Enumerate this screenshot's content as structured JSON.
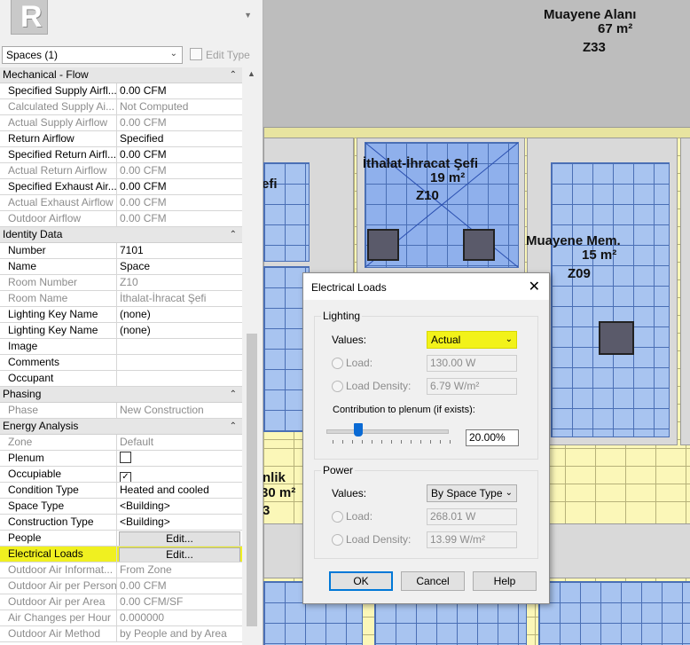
{
  "properties": {
    "type_selector_label": "Spaces (1)",
    "edit_type_label": "Edit Type",
    "groups": [
      {
        "title": "Mechanical - Flow",
        "rows": [
          {
            "key": "Specified Supply Airfl...",
            "value": "0.00 CFM",
            "enabled": true
          },
          {
            "key": "Calculated Supply Ai...",
            "value": "Not Computed",
            "enabled": false
          },
          {
            "key": "Actual Supply Airflow",
            "value": "0.00 CFM",
            "enabled": false
          },
          {
            "key": "Return Airflow",
            "value": "Specified",
            "enabled": true
          },
          {
            "key": "Specified Return Airfl...",
            "value": "0.00 CFM",
            "enabled": true
          },
          {
            "key": "Actual Return Airflow",
            "value": "0.00 CFM",
            "enabled": false
          },
          {
            "key": "Specified Exhaust Air...",
            "value": "0.00 CFM",
            "enabled": true
          },
          {
            "key": "Actual Exhaust Airflow",
            "value": "0.00 CFM",
            "enabled": false
          },
          {
            "key": "Outdoor Airflow",
            "value": "0.00 CFM",
            "enabled": false
          }
        ]
      },
      {
        "title": "Identity Data",
        "rows": [
          {
            "key": "Number",
            "value": "7101",
            "enabled": true
          },
          {
            "key": "Name",
            "value": "Space",
            "enabled": true
          },
          {
            "key": "Room Number",
            "value": "Z10",
            "enabled": false
          },
          {
            "key": "Room Name",
            "value": "İthalat-İhracat Şefi",
            "enabled": false
          },
          {
            "key": "Lighting Key Name",
            "value": "(none)",
            "enabled": true
          },
          {
            "key": "Lighting Key Name",
            "value": "(none)",
            "enabled": true
          },
          {
            "key": "Image",
            "value": "",
            "enabled": true
          },
          {
            "key": "Comments",
            "value": "",
            "enabled": true
          },
          {
            "key": "Occupant",
            "value": "",
            "enabled": true
          }
        ]
      },
      {
        "title": "Phasing",
        "rows": [
          {
            "key": "Phase",
            "value": "New Construction",
            "enabled": false
          }
        ]
      },
      {
        "title": "Energy Analysis",
        "rows": [
          {
            "key": "Zone",
            "value": "Default",
            "enabled": false
          },
          {
            "key": "Plenum",
            "value": "",
            "enabled": true,
            "checkbox": false
          },
          {
            "key": "Occupiable",
            "value": "",
            "enabled": true,
            "checkbox": true
          },
          {
            "key": "Condition Type",
            "value": "Heated and cooled",
            "enabled": true
          },
          {
            "key": "Space Type",
            "value": "<Building>",
            "enabled": true
          },
          {
            "key": "Construction Type",
            "value": "<Building>",
            "enabled": true
          },
          {
            "key": "People",
            "value": "Edit...",
            "enabled": true,
            "button": true
          },
          {
            "key": "Electrical Loads",
            "value": "Edit...",
            "enabled": true,
            "button": true,
            "highlight": true
          },
          {
            "key": "Outdoor Air Informat...",
            "value": "From Zone",
            "enabled": false
          },
          {
            "key": "Outdoor Air per Person",
            "value": "0.00 CFM",
            "enabled": false
          },
          {
            "key": "Outdoor Air per Area",
            "value": "0.00 CFM/SF",
            "enabled": false
          },
          {
            "key": "Air Changes per Hour",
            "value": "0.000000",
            "enabled": false
          },
          {
            "key": "Outdoor Air Method",
            "value": "by People and by Area",
            "enabled": false
          }
        ]
      }
    ]
  },
  "canvas": {
    "rooms": [
      {
        "name": "Muayene Alanı",
        "area": "67 m²",
        "number": "Z33"
      },
      {
        "name": "İthalat-İhracat Şefi",
        "area": "19 m²",
        "number": "Z10"
      },
      {
        "name": "Muayene Mem.",
        "area": "15 m²",
        "number": "Z09"
      },
      {
        "name_fragment": "efi"
      },
      {
        "name_fragment": "nlik",
        "area_fragment": "30 m²",
        "number_fragment": "3"
      }
    ]
  },
  "dialog": {
    "title": "Electrical Loads",
    "close_label": "✕",
    "lighting": {
      "group_label": "Lighting",
      "values_label": "Values:",
      "values_selected": "Actual",
      "load_label": "Load:",
      "load_value": "130.00 W",
      "density_label": "Load Density:",
      "density_value": "6.79 W/m²",
      "contribution_label": "Contribution to plenum (if exists):",
      "contribution_value": "20.00%",
      "contribution_fraction": 0.2
    },
    "power": {
      "group_label": "Power",
      "values_label": "Values:",
      "values_selected": "By Space Type",
      "load_label": "Load:",
      "load_value": "268.01 W",
      "density_label": "Load Density:",
      "density_value": "13.99 W/m²"
    },
    "buttons": {
      "ok": "OK",
      "cancel": "Cancel",
      "help": "Help"
    }
  },
  "colors": {
    "highlight": "#f2f21a",
    "room_fill": "#a8c4f0",
    "accent": "#0078d7"
  }
}
